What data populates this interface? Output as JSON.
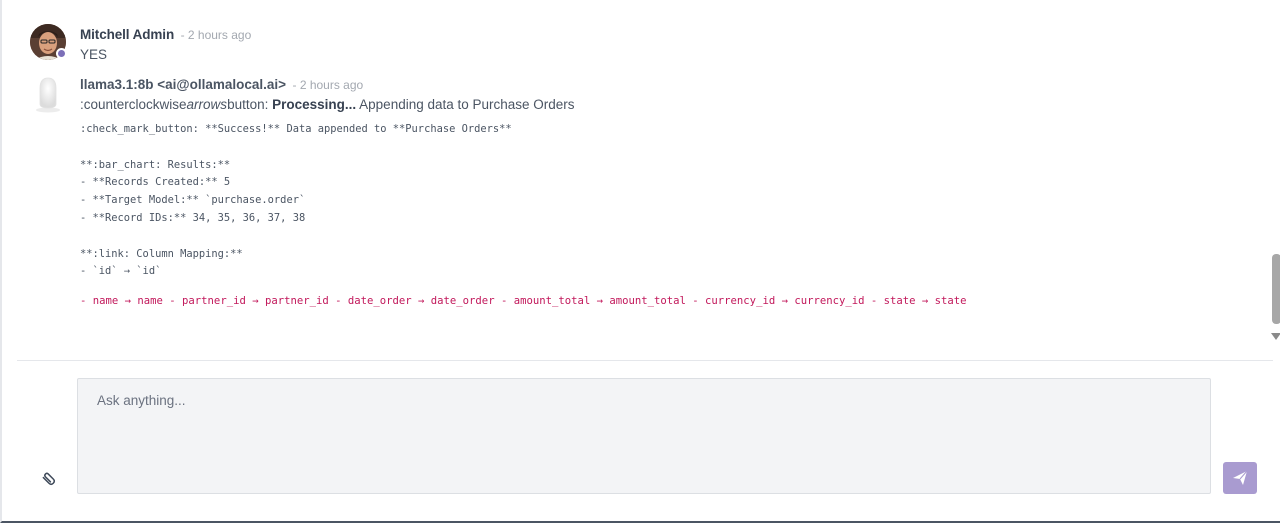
{
  "thread": {
    "messages": [
      {
        "author": "Mitchell Admin",
        "time": "- 2 hours ago",
        "text": "YES"
      },
      {
        "author": "llama3.1:8b <ai@ollamalocal.ai>",
        "time": "- 2 hours ago",
        "status_prefix": ":counterclockwise",
        "status_italic": "arrows",
        "status_suffix": "button: ",
        "status_bold": "Processing...",
        "status_rest": " Appending data to Purchase Orders",
        "code_lines": [
          ":check_mark_button: **Success!** Data appended to **Purchase Orders**",
          "",
          "**:bar_chart: Results:**",
          "- **Records Created:** 5",
          "- **Target Model:** `purchase.order`",
          "- **Record IDs:** 34, 35, 36, 37, 38",
          "",
          "**:link: Column Mapping:**",
          "- `id` → `id`"
        ],
        "mapping_line": "- name → name - partner_id → partner_id - date_order → date_order - amount_total → amount_total - currency_id → currency_id - state → state"
      }
    ]
  },
  "composer": {
    "placeholder": "Ask anything..."
  },
  "icons": {
    "attach": "paperclip-icon",
    "send": "paper-plane-icon",
    "user_status": "online-status-dot"
  },
  "colors": {
    "accent": "#a99bd0",
    "status_dot": "#7c6fb8",
    "mapping_text": "#c2185b"
  }
}
